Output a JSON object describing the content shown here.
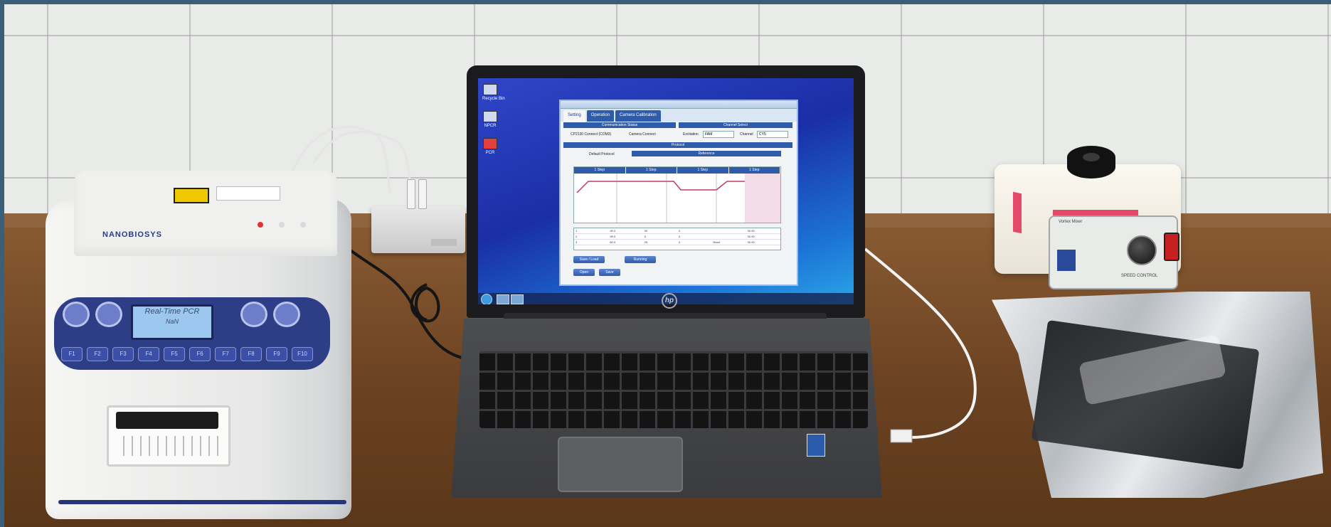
{
  "pcr_machine": {
    "brand": "NANOBIOSYS",
    "display_line1": "Real-Time PCR",
    "display_line2": "NaN",
    "function_keys": [
      "F1",
      "F2",
      "F3",
      "F4",
      "F5",
      "F6",
      "F7",
      "F8",
      "F9",
      "F10"
    ]
  },
  "laptop": {
    "logo": "hp",
    "app": {
      "tabs": [
        "Setting",
        "Operation",
        "Camera Calibration"
      ],
      "active_tab": "Setting",
      "communication_section": "Communication Status",
      "channel_section": "Channel Select",
      "protocol_section": "Protocol",
      "device_status": "CP2130 Connect (COM3)",
      "camera_status": "Camera Connect",
      "excitation_label": "Excitation",
      "excitation_value": "FAM",
      "channel_label": "Channel",
      "channel_value": "CY5",
      "default_protocol_label": "Default Protocol",
      "reference_label": "Reference",
      "step_headers": [
        "1 Step",
        "1 Step",
        "1 Step",
        "1 Step"
      ],
      "table_rows": [
        [
          "1",
          "95.0",
          "30",
          "0",
          "",
          "30.00"
        ],
        [
          "2",
          "95.0",
          "5",
          "0",
          "",
          "30.00"
        ],
        [
          "3",
          "60.0",
          "25",
          "0",
          "Read",
          "30.00"
        ]
      ],
      "buttons": [
        "Save / Load",
        "Running",
        "Open",
        "Save"
      ]
    },
    "desktop_icons": [
      "Recycle Bin",
      "NPCR",
      "PCR"
    ]
  },
  "vortex_mixer": {
    "label": "Vortex Mixer",
    "knob_label": "SPEED CONTROL"
  },
  "colors": {
    "keypad": "#2d3d86",
    "screen_blue": "#1a2ea6",
    "app_accent": "#2e5baa",
    "switch_red": "#c62020"
  }
}
